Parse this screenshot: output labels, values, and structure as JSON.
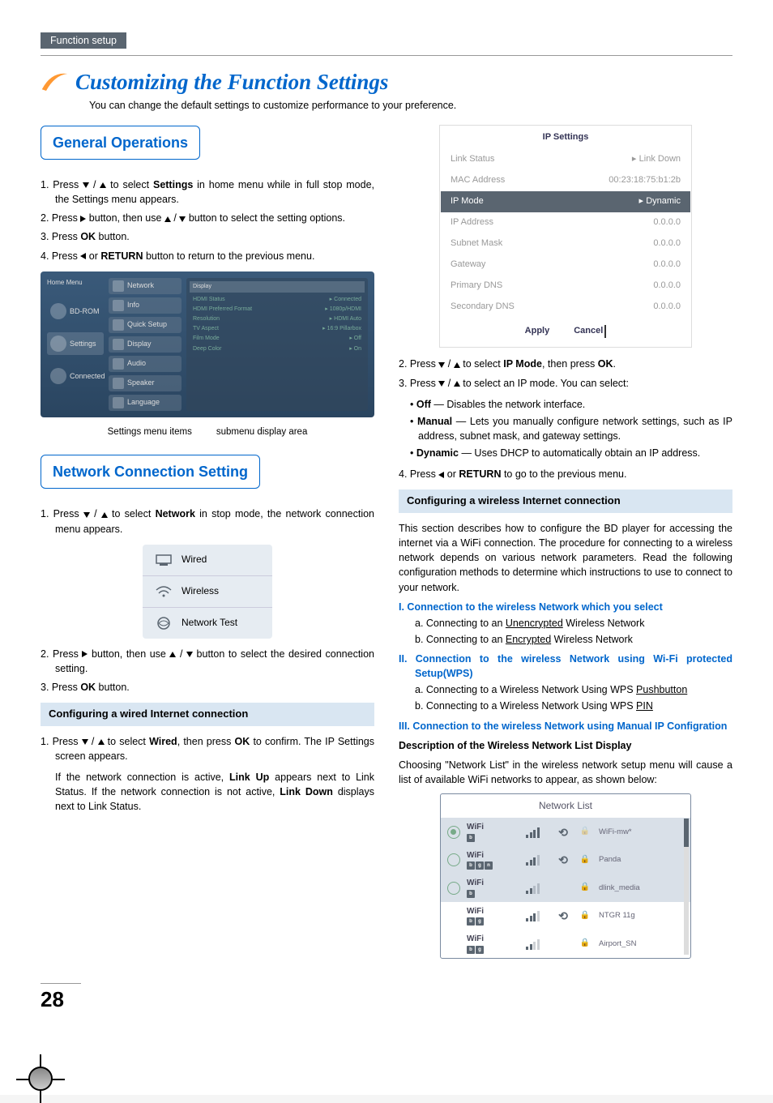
{
  "header": {
    "section": "Function setup"
  },
  "title": "Customizing the Function Settings",
  "subtitle": "You can change the default settings to customize performance to your preference.",
  "general": {
    "heading": "General Operations",
    "steps": {
      "s1a": "1.  Press ",
      "s1b": " to select ",
      "s1c": "Settings",
      "s1d": " in home menu while in full stop mode, the Settings menu appears.",
      "s2a": "2.  Press ",
      "s2b": " button, then use ",
      "s2c": " button to select the setting options.",
      "s3a": "3.  Press ",
      "s3b": "OK",
      "s3c": " button.",
      "s4a": "4.  Press ",
      "s4b": " or ",
      "s4c": "RETURN",
      "s4d": " button to return to the previous menu."
    }
  },
  "settingsShot": {
    "home": "Home Menu",
    "left": {
      "bd": "BD-ROM",
      "set": "Settings",
      "con": "Connected"
    },
    "mid": {
      "network": "Network",
      "info": "Info",
      "quick": "Quick Setup",
      "display": "Display",
      "audio": "Audio",
      "speaker": "Speaker",
      "language": "Language"
    },
    "right": {
      "hdr": "Display",
      "r1l": "HDMI Status",
      "r1v": "Connected",
      "r2l": "HDMI Preferred Format",
      "r2v": "1080p/HDMI",
      "r3l": "Resolution",
      "r3v": "HDMI Auto",
      "r4l": "TV Aspect",
      "r4v": "16:9 Pillarbox",
      "r5l": "Film Mode",
      "r5v": "Off",
      "r6l": "Deep Color",
      "r6v": "On"
    }
  },
  "caption": {
    "a": "Settings menu items",
    "b": "submenu display area"
  },
  "network": {
    "heading": "Network Connection Setting",
    "s1a": "1.  Press ",
    "s1b": " to select ",
    "s1c": "Network",
    "s1d": " in stop mode, the network connection menu appears.",
    "menu": {
      "wired": "Wired",
      "wireless": "Wireless",
      "test": "Network Test"
    },
    "s2a": "2.  Press ",
    "s2b": " button, then use ",
    "s2c": " button to select the desired connection setting.",
    "s3a": "3.  Press ",
    "s3b": "OK",
    "s3c": " button."
  },
  "wired": {
    "heading": "Configuring a wired Internet connection",
    "s1a": "1.  Press ",
    "s1b": " to select ",
    "s1c": "Wired",
    "s1d": ", then press ",
    "s1e": "OK",
    "s1f": " to confirm. The IP Settings screen appears.",
    "p2a": "If the network connection is active, ",
    "p2b": "Link Up",
    "p2c": " appears next to Link Status. If the network connection is not active, ",
    "p2d": "Link Down",
    "p2e": " displays next to Link Status."
  },
  "ip": {
    "title": "IP Settings",
    "link": "Link Status",
    "linkv": "Link Down",
    "mac": "MAC Address",
    "macv": "00:23:18:75:b1:2b",
    "mode": "IP Mode",
    "modev": "Dynamic",
    "addr": "IP Address",
    "addrv": "0.0.0.0",
    "mask": "Subnet Mask",
    "maskv": "0.0.0.0",
    "gw": "Gateway",
    "gwv": "0.0.0.0",
    "pdns": "Primary DNS",
    "pdnsv": "0.0.0.0",
    "sdns": "Secondary DNS",
    "sdnsv": "0.0.0.0",
    "apply": "Apply",
    "cancel": "Cancel"
  },
  "ipsteps": {
    "s2a": "2.  Press ",
    "s2b": " to select ",
    "s2c": "IP Mode",
    "s2d": ", then press ",
    "s2e": "OK",
    "s2f": ".",
    "s3a": "3.  Press ",
    "s3b": " to select an IP mode. You can select:",
    "off1": "Off",
    "off2": " — Disables the network interface.",
    "man1": "Manual",
    "man2": " — Lets you manually configure network settings, such as IP address, subnet mask, and gateway settings.",
    "dyn1": "Dynamic",
    "dyn2": " — Uses DHCP to automatically obtain an IP address.",
    "s4a": "4.  Press ",
    "s4b": " or ",
    "s4c": "RETURN",
    "s4d": " to go to the previous menu."
  },
  "wireless": {
    "heading": "Configuring a wireless Internet connection",
    "intro": "This section describes how to configure the BD player for accessing the internet via a WiFi connection. The procedure for connecting to a wireless network depends on various network parameters. Read the following configuration methods to determine which instructions to use to connect to your network.",
    "i_t": "I.  Connection to the wireless Network which you select",
    "i_a1": "a. Connecting to an ",
    "i_a2": "Unencrypted",
    "i_a3": " Wireless Network",
    "i_b1": "b. Connecting to an ",
    "i_b2": "Encrypted",
    "i_b3": " Wireless Network",
    "ii_t": "II. Connection to the wireless Network using Wi-Fi protected Setup(WPS)",
    "ii_a1": "a. Connecting to a Wireless Network Using WPS ",
    "ii_a2": "Pushbutton",
    "ii_b1": "b. Connecting to a Wireless Network Using WPS ",
    "ii_b2": "PIN",
    "iii_t": "III. Connection to the wireless Network using Manual IP Configration",
    "desc": "Description of the Wireless Network List Display",
    "choose": "Choosing \"Network List\" in the wireless network setup menu will cause a list of available WiFi networks to appear, as shown below:"
  },
  "netlist": {
    "title": "Network List",
    "ssid": "WiFi",
    "names": [
      "WiFi-mw*",
      "Panda",
      "dlink_media",
      "NTGR 11g",
      "Airport_SN"
    ]
  },
  "page": "28"
}
